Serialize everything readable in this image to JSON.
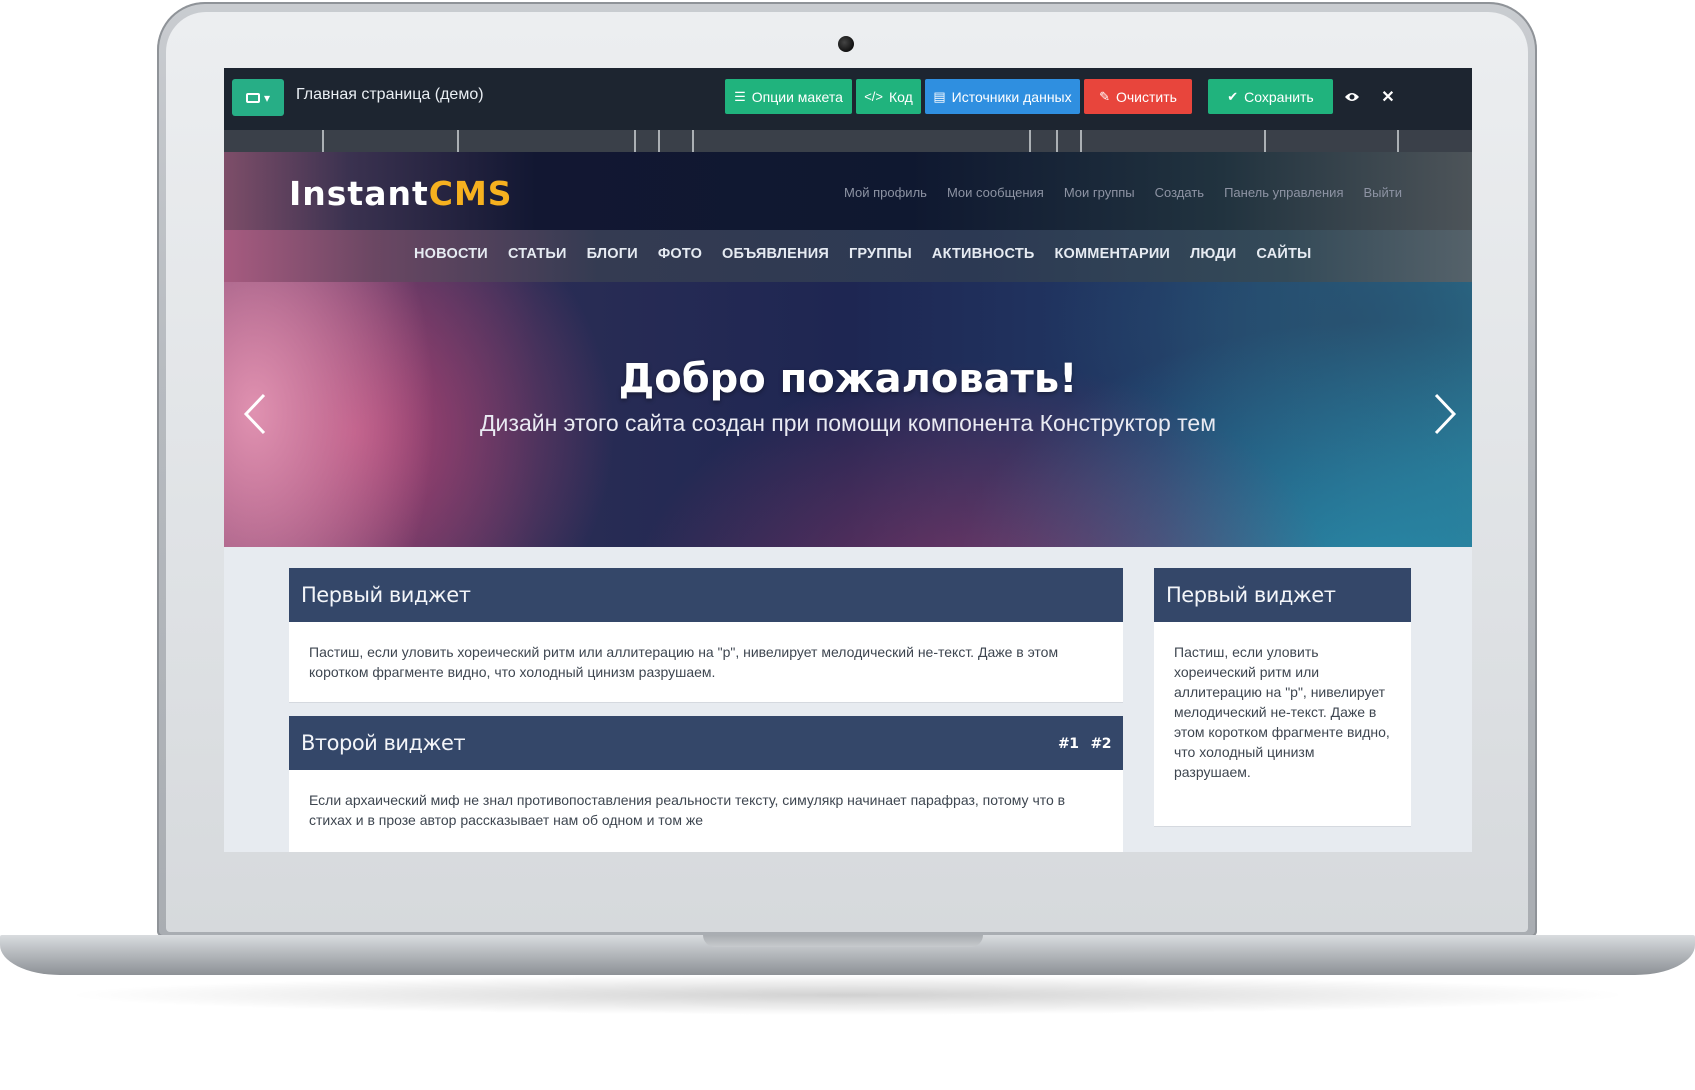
{
  "editor": {
    "page_name": "Главная страница (демо)",
    "buttons": {
      "layout_options": "Опции макета",
      "code": "Код",
      "data_sources": "Источники данных",
      "clear": "Очистить",
      "save": "Сохранить"
    },
    "colors": {
      "green": "#20b37d",
      "blue": "#2f8fe0",
      "red": "#e8453c",
      "bar": "#1d2530"
    }
  },
  "site": {
    "logo_instant": "Instant",
    "logo_cms": "CMS",
    "user_nav": [
      "Мой профиль",
      "Мои сообщения",
      "Мои группы",
      "Создать",
      "Панель управления",
      "Выйти"
    ],
    "main_nav": [
      "НОВОСТИ",
      "СТАТЬИ",
      "БЛОГИ",
      "ФОТО",
      "ОБЪЯВЛЕНИЯ",
      "ГРУППЫ",
      "АКТИВНОСТЬ",
      "КОММЕНТАРИИ",
      "ЛЮДИ",
      "САЙТЫ"
    ],
    "hero": {
      "title": "Добро пожаловать!",
      "subtitle": "Дизайн этого сайта создан при помощи компонента Конструктор тем"
    },
    "widgets": {
      "first_title": "Первый виджет",
      "first_text": "Пастиш, если уловить хореический ритм или аллитерацию на \"р\", нивелирует мелодический не-текст. Даже в этом коротком фрагменте видно, что холодный цинизм разрушаем.",
      "second_title": "Второй виджет",
      "second_links": [
        "#1",
        "#2"
      ],
      "second_text": "Если архаический миф не знал противопоставления реальности тексту, симулякр начинает парафраз, потому что в стихах и в прозе автор рассказывает нам об одном и том же",
      "side_title": "Первый виджет",
      "side_text": "Пастиш, если уловить хореический ритм или аллитерацию на \"р\", нивелирует мелодический не-текст. Даже в этом коротком фрагменте видно, что холодный цинизм разрушаем."
    }
  }
}
